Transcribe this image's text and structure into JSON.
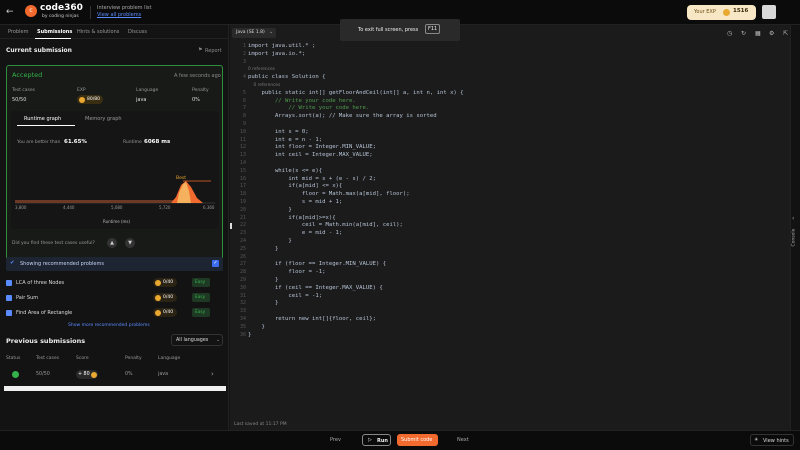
{
  "header": {
    "logo_text": "code",
    "logo_num": "360",
    "logo_sub": "by coding ninjas",
    "breadcrumb_title": "Interview problem list",
    "breadcrumb_link": "View all problems",
    "exp_label": "Your EXP",
    "exp_value": "1516",
    "language": "Java (SE 1.8)",
    "fullscreen_text": "To exit full screen, press",
    "fullscreen_key": "F11"
  },
  "tabs": [
    "Problem",
    "Submissions",
    "Hints & solutions",
    "Discuss"
  ],
  "active_tab": 1,
  "submission": {
    "title": "Current submission",
    "report": "Report",
    "status": "Accepted",
    "time": "A few seconds ago",
    "test_cases_label": "Test cases",
    "test_cases": "50/50",
    "exp_label": "EXP",
    "exp": "80/80",
    "language_label": "Language",
    "language": "java",
    "penalty_label": "Penalty",
    "penalty": "0%",
    "runtime_tab": "Runtime graph",
    "memory_tab": "Memory graph",
    "better_than_label": "You are better than",
    "better_than": "61.65%",
    "runtime_label": "Runtime",
    "runtime": "6068 ms",
    "best_label": "Best",
    "x_ticks": [
      "3,800",
      "4,440",
      "5,080",
      "5,720",
      "6,360"
    ],
    "x_label": "Runtime (ms)",
    "feedback": "Did you find these test cases useful?"
  },
  "recommended": {
    "header": "Showing recommended problems",
    "items": [
      {
        "name": "LCA of three Nodes",
        "exp": "0/40",
        "level": "Easy"
      },
      {
        "name": "Pair Sum",
        "exp": "0/40",
        "level": "Easy"
      },
      {
        "name": "Find Area of Rectangle",
        "exp": "0/40",
        "level": "Easy"
      }
    ],
    "more": "Show more recommended problems"
  },
  "previous": {
    "title": "Previous submissions",
    "filter": "All languages",
    "headers": [
      "Status",
      "Test cases",
      "Score",
      "Penalty",
      "Language"
    ],
    "rows": [
      {
        "test_cases": "50/50",
        "score": "+ 80",
        "penalty": "0%",
        "language": "java"
      }
    ]
  },
  "code": {
    "lines": [
      {
        "n": "1",
        "t": "import java.util.* ;"
      },
      {
        "n": "2",
        "t": "import java.io.*;"
      },
      {
        "n": "3",
        "t": ""
      },
      {
        "n": "",
        "t": "0 references",
        "ref": true
      },
      {
        "n": "4",
        "t": "public class Solution {"
      },
      {
        "n": "",
        "t": "    0 references",
        "ref": true
      },
      {
        "n": "5",
        "t": "    public static int[] getFloorAndCeil(int[] a, int n, int x) {"
      },
      {
        "n": "6",
        "t": "        // Write your code here.",
        "c": true
      },
      {
        "n": "7",
        "t": "            // Write your code here.",
        "c": true
      },
      {
        "n": "8",
        "t": "        Arrays.sort(a); // Make sure the array is sorted"
      },
      {
        "n": "9",
        "t": ""
      },
      {
        "n": "10",
        "t": "        int s = 0;"
      },
      {
        "n": "11",
        "t": "        int e = n - 1;"
      },
      {
        "n": "12",
        "t": "        int floor = Integer.MIN_VALUE;"
      },
      {
        "n": "13",
        "t": "        int ceil = Integer.MAX_VALUE;"
      },
      {
        "n": "14",
        "t": ""
      },
      {
        "n": "15",
        "t": "        while(s <= e){"
      },
      {
        "n": "16",
        "t": "            int mid = s + (e - s) / 2;"
      },
      {
        "n": "17",
        "t": "            if(a[mid] <= x){"
      },
      {
        "n": "18",
        "t": "                floor = Math.max(a[mid], floor);"
      },
      {
        "n": "19",
        "t": "                s = mid + 1;"
      },
      {
        "n": "20",
        "t": "            }"
      },
      {
        "n": "21",
        "t": "            if(a[mid]>=x){"
      },
      {
        "n": "22",
        "t": "                ceil = Math.min(a[mid], ceil);"
      },
      {
        "n": "23",
        "t": "                e = mid - 1;"
      },
      {
        "n": "24",
        "t": "            }"
      },
      {
        "n": "25",
        "t": "        }"
      },
      {
        "n": "26",
        "t": ""
      },
      {
        "n": "27",
        "t": "        if (floor == Integer.MIN_VALUE) {"
      },
      {
        "n": "28",
        "t": "            floor = -1;"
      },
      {
        "n": "29",
        "t": "        }"
      },
      {
        "n": "30",
        "t": "        if (ceil == Integer.MAX_VALUE) {"
      },
      {
        "n": "31",
        "t": "            ceil = -1;"
      },
      {
        "n": "32",
        "t": "        }"
      },
      {
        "n": "33",
        "t": ""
      },
      {
        "n": "34",
        "t": "        return new int[]{floor, ceil};"
      },
      {
        "n": "35",
        "t": "    }"
      },
      {
        "n": "36",
        "t": "}"
      }
    ],
    "last_saved": "Last saved at 11:17 PM"
  },
  "console_label": "Console",
  "footer": {
    "prev": "Prev",
    "run": "Run",
    "submit": "Submit code",
    "next": "Next",
    "hints": "View hints"
  },
  "colors": {
    "accent": "#f26a2e",
    "green": "#35b24b",
    "gold": "#e9a930",
    "bg": "#131313"
  }
}
